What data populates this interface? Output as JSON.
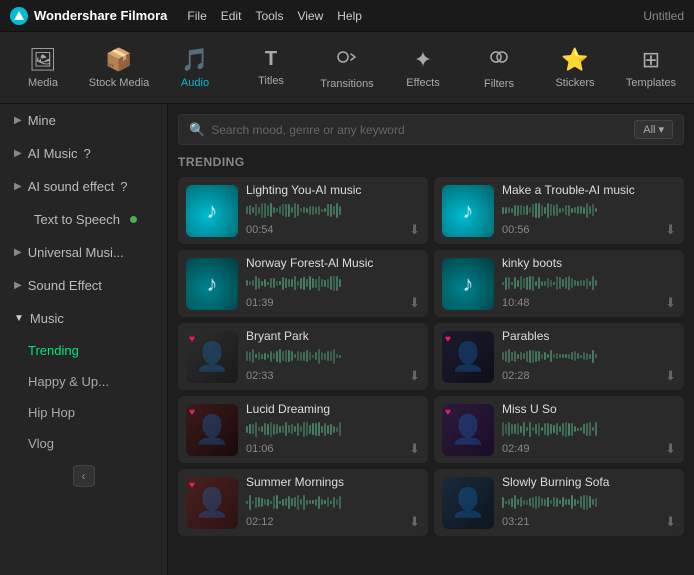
{
  "app": {
    "name": "Wondershare Filmora",
    "title": "Untitled"
  },
  "titlebar": {
    "menus": [
      "File",
      "Edit",
      "Tools",
      "View",
      "Help"
    ]
  },
  "toolbar": {
    "items": [
      {
        "id": "media",
        "label": "Media",
        "icon": "🖼"
      },
      {
        "id": "stock-media",
        "label": "Stock Media",
        "icon": "📦"
      },
      {
        "id": "audio",
        "label": "Audio",
        "icon": "🎵",
        "active": true
      },
      {
        "id": "titles",
        "label": "Titles",
        "icon": "T"
      },
      {
        "id": "transitions",
        "label": "Transitions",
        "icon": "↔"
      },
      {
        "id": "effects",
        "label": "Effects",
        "icon": "✦"
      },
      {
        "id": "filters",
        "label": "Filters",
        "icon": "🔮"
      },
      {
        "id": "stickers",
        "label": "Stickers",
        "icon": "⭐"
      },
      {
        "id": "templates",
        "label": "Templates",
        "icon": "⊞"
      }
    ]
  },
  "sidebar": {
    "items": [
      {
        "id": "mine",
        "label": "Mine",
        "type": "collapsed",
        "indent": 0
      },
      {
        "id": "ai-music",
        "label": "AI Music",
        "type": "collapsed",
        "help": "?",
        "indent": 0
      },
      {
        "id": "ai-sound-effect",
        "label": "AI sound effect",
        "type": "collapsed",
        "help": "?",
        "indent": 0
      },
      {
        "id": "text-to-speech",
        "label": "Text to Speech",
        "type": "leaf",
        "badge": true,
        "indent": 0
      },
      {
        "id": "universal-music",
        "label": "Universal Musi...",
        "type": "collapsed",
        "indent": 0
      },
      {
        "id": "sound-effect",
        "label": "Sound Effect",
        "type": "collapsed",
        "indent": 0
      },
      {
        "id": "music",
        "label": "Music",
        "type": "expanded",
        "indent": 0
      }
    ],
    "music_sub": [
      {
        "id": "trending",
        "label": "Trending",
        "active": true
      },
      {
        "id": "happy-up",
        "label": "Happy & Up..."
      },
      {
        "id": "hip-hop",
        "label": "Hip Hop"
      },
      {
        "id": "vlog",
        "label": "Vlog"
      }
    ]
  },
  "search": {
    "placeholder": "Search mood, genre or any keyword",
    "filter_label": "All"
  },
  "trending": {
    "label": "TRENDING",
    "items": [
      {
        "id": "lighting-you",
        "title": "Lighting You-AI music",
        "duration": "00:54",
        "thumb_type": "teal"
      },
      {
        "id": "make-a-trouble",
        "title": "Make a Trouble-AI music",
        "duration": "00:56",
        "thumb_type": "teal"
      },
      {
        "id": "norway-forest",
        "title": "Norway Forest-Al Music",
        "duration": "01:39",
        "thumb_type": "dark-teal"
      },
      {
        "id": "kinky-boots",
        "title": "kinky boots",
        "duration": "10:48",
        "thumb_type": "dark-teal"
      },
      {
        "id": "bryant-park",
        "title": "Bryant Park",
        "duration": "02:33",
        "thumb_type": "person1",
        "has_heart": true
      },
      {
        "id": "parables",
        "title": "Parables",
        "duration": "02:28",
        "thumb_type": "person2",
        "has_heart": true
      },
      {
        "id": "lucid-dreaming",
        "title": "Lucid Dreaming",
        "duration": "01:06",
        "thumb_type": "person3",
        "has_heart": true
      },
      {
        "id": "miss-u-so",
        "title": "Miss U So",
        "duration": "02:49",
        "thumb_type": "person4",
        "has_heart": true
      },
      {
        "id": "summer-mornings",
        "title": "Summer Mornings",
        "duration": "02:12",
        "thumb_type": "morning",
        "has_heart": true
      },
      {
        "id": "slowly-burning-sofa",
        "title": "Slowly Burning Sofa",
        "duration": "03:21",
        "thumb_type": "sofa",
        "has_heart": false
      }
    ]
  }
}
